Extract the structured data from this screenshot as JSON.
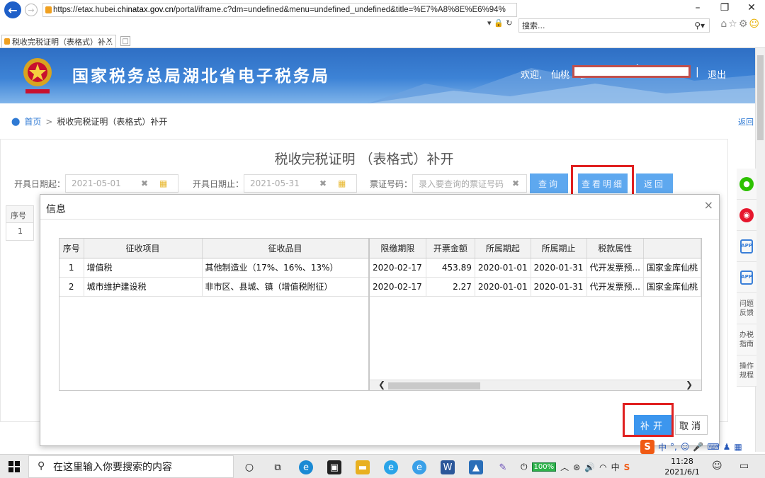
{
  "browser": {
    "url_prefix": "https://etax.hubei.",
    "url_domain": "chinatax.gov.cn",
    "url_rest": "/portal/iframe.c?dm=undefined&menu=undefined_undefined&title=%E7%A8%8E%E6%94%",
    "search_placeholder": "搜索...",
    "tab_title": "税收完税证明（表格式）补...",
    "window_controls": [
      "–",
      "❐",
      "✕"
    ]
  },
  "header": {
    "site_title": "国家税务总局湖北省电子税务局",
    "welcome": "欢迎,",
    "user_name": "仙桃",
    "logout": "退出"
  },
  "breadcrumb": {
    "home": "首页",
    "separator": ">",
    "current": "税收完税证明（表格式）补开",
    "back": "返回"
  },
  "form": {
    "title": "税收完税证明 （表格式）补开",
    "start_label": "开具日期起：",
    "start_value": "2021-05-01",
    "end_label": "开具日期止：",
    "end_value": "2021-05-31",
    "ticket_label": "票证号码：",
    "ticket_placeholder": "录入要查询的票证号码",
    "query_btn": "查询",
    "detail_btn": "查看明细",
    "return_btn": "返回",
    "behind_col": "序号",
    "behind_row": "1"
  },
  "float_bar": [
    "问题反馈",
    "办税指南",
    "操作规程"
  ],
  "dialog": {
    "title": "信息",
    "close": "×",
    "left_columns": [
      "序号",
      "征收项目",
      "征收品目"
    ],
    "right_columns": [
      "限缴期限",
      "开票金额",
      "所属期起",
      "所属期止",
      "税款属性",
      ""
    ],
    "rows": [
      {
        "no": "1",
        "item": "增值税",
        "subitem": "其他制造业（17%、16%、13%）",
        "deadline": "2020-02-17",
        "amount": "453.89",
        "period_start": "2020-01-01",
        "period_end": "2020-01-31",
        "attribute": "代开发票预...",
        "treasury": "国家金库仙桃"
      },
      {
        "no": "2",
        "item": "城市维护建设税",
        "subitem": "非市区、县城、镇（增值税附征）",
        "deadline": "2020-02-17",
        "amount": "2.27",
        "period_start": "2020-01-01",
        "period_end": "2020-01-31",
        "attribute": "代开发票预...",
        "treasury": "国家金库仙桃"
      }
    ],
    "confirm_btn": "补开",
    "cancel_btn": "取消"
  },
  "ime": {
    "logo": "S",
    "lang": "中"
  },
  "taskbar": {
    "search_placeholder": "在这里输入你要搜索的内容",
    "battery": "100%",
    "time": "11:28",
    "date": "2021/6/1"
  },
  "colors": {
    "header_blue": "#2f6fc4",
    "button_blue": "#3c96ee",
    "highlight_red": "#e02020",
    "link_blue": "#2f7ad4"
  }
}
